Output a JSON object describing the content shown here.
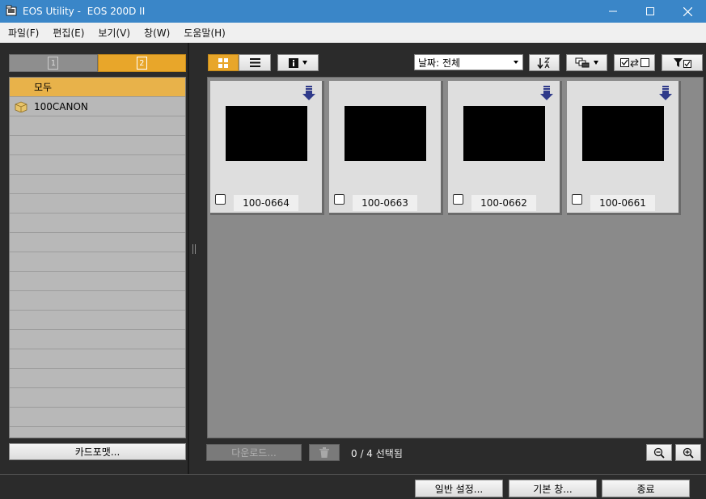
{
  "window": {
    "title": "EOS Utility -",
    "device": "EOS 200D II",
    "minimize": "—",
    "maximize": "☐",
    "close": "✕"
  },
  "menu": [
    "파일(F)",
    "편집(E)",
    "보기(V)",
    "창(W)",
    "도움말(H)"
  ],
  "card_tabs": [
    {
      "label": "1",
      "active": false
    },
    {
      "label": "2",
      "active": true
    }
  ],
  "folders": [
    {
      "label": "모두",
      "selected": true,
      "icon": ""
    },
    {
      "label": "100CANON",
      "selected": false,
      "icon": "folder-icon"
    }
  ],
  "empty_rows": 16,
  "format_button": "카드포맷...",
  "toolbar": {
    "date_filter": "날짜: 전체"
  },
  "thumbnails": [
    {
      "name": "100-0664",
      "download_icon": true
    },
    {
      "name": "100-0663",
      "download_icon": false
    },
    {
      "name": "100-0662",
      "download_icon": true
    },
    {
      "name": "100-0661",
      "download_icon": true
    }
  ],
  "download_button": "다운로드...",
  "selection_count": "0 / 4  선택됨",
  "footer": {
    "general_settings": "일반 설정...",
    "main_window": "기본 창...",
    "exit": "종료"
  },
  "colors": {
    "titlebar": "#3a86c8",
    "accent": "#e8a62a",
    "download_arrow": "#2f3a8a"
  }
}
